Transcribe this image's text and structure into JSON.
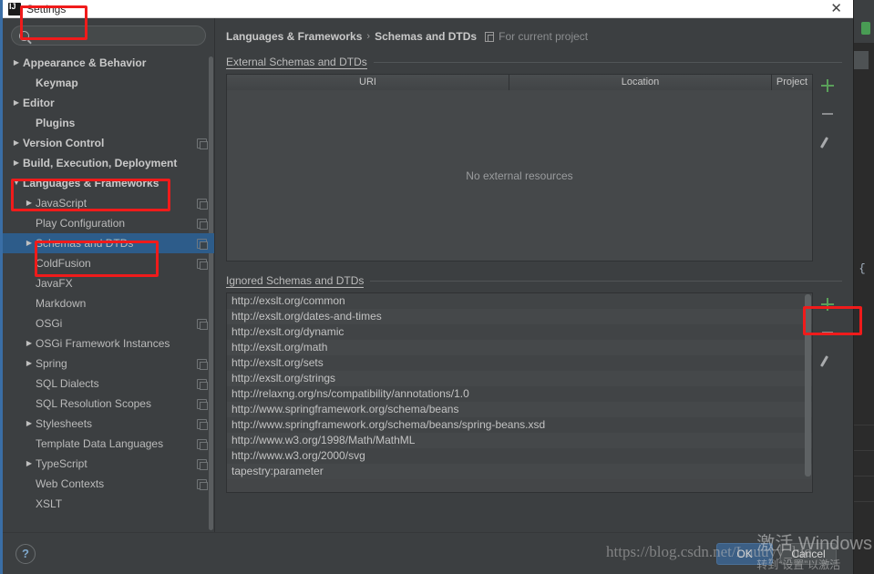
{
  "window": {
    "title": "Settings",
    "close_label": "✕"
  },
  "background": {
    "code_snippet": "n {"
  },
  "search": {
    "value": "",
    "placeholder": "",
    "icon": "search-icon"
  },
  "sidebar": {
    "scrollbar": "vertical-scrollbar",
    "items": [
      {
        "label": "Appearance & Behavior",
        "arrow": "▶",
        "indent": 1,
        "bold": true,
        "selected": false,
        "project_icon": false
      },
      {
        "label": "Keymap",
        "arrow": "",
        "indent": 2,
        "bold": true,
        "selected": false,
        "project_icon": false
      },
      {
        "label": "Editor",
        "arrow": "▶",
        "indent": 1,
        "bold": true,
        "selected": false,
        "project_icon": false
      },
      {
        "label": "Plugins",
        "arrow": "",
        "indent": 2,
        "bold": true,
        "selected": false,
        "project_icon": false
      },
      {
        "label": "Version Control",
        "arrow": "▶",
        "indent": 1,
        "bold": true,
        "selected": false,
        "project_icon": true
      },
      {
        "label": "Build, Execution, Deployment",
        "arrow": "▶",
        "indent": 1,
        "bold": true,
        "selected": false,
        "project_icon": false
      },
      {
        "label": "Languages & Frameworks",
        "arrow": "▼",
        "indent": 1,
        "bold": true,
        "selected": false,
        "project_icon": false
      },
      {
        "label": "JavaScript",
        "arrow": "▶",
        "indent": 2,
        "bold": false,
        "selected": false,
        "project_icon": true
      },
      {
        "label": "Play Configuration",
        "arrow": "",
        "indent": 3,
        "bold": false,
        "selected": false,
        "project_icon": true
      },
      {
        "label": "Schemas and DTDs",
        "arrow": "▶",
        "indent": 2,
        "bold": false,
        "selected": true,
        "project_icon": true
      },
      {
        "label": "ColdFusion",
        "arrow": "",
        "indent": 3,
        "bold": false,
        "selected": false,
        "project_icon": true
      },
      {
        "label": "JavaFX",
        "arrow": "",
        "indent": 3,
        "bold": false,
        "selected": false,
        "project_icon": false
      },
      {
        "label": "Markdown",
        "arrow": "",
        "indent": 3,
        "bold": false,
        "selected": false,
        "project_icon": false
      },
      {
        "label": "OSGi",
        "arrow": "",
        "indent": 3,
        "bold": false,
        "selected": false,
        "project_icon": true
      },
      {
        "label": "OSGi Framework Instances",
        "arrow": "▶",
        "indent": 2,
        "bold": false,
        "selected": false,
        "project_icon": false
      },
      {
        "label": "Spring",
        "arrow": "▶",
        "indent": 2,
        "bold": false,
        "selected": false,
        "project_icon": true
      },
      {
        "label": "SQL Dialects",
        "arrow": "",
        "indent": 3,
        "bold": false,
        "selected": false,
        "project_icon": true
      },
      {
        "label": "SQL Resolution Scopes",
        "arrow": "",
        "indent": 3,
        "bold": false,
        "selected": false,
        "project_icon": true
      },
      {
        "label": "Stylesheets",
        "arrow": "▶",
        "indent": 2,
        "bold": false,
        "selected": false,
        "project_icon": true
      },
      {
        "label": "Template Data Languages",
        "arrow": "",
        "indent": 3,
        "bold": false,
        "selected": false,
        "project_icon": true
      },
      {
        "label": "TypeScript",
        "arrow": "▶",
        "indent": 2,
        "bold": false,
        "selected": false,
        "project_icon": true
      },
      {
        "label": "Web Contexts",
        "arrow": "",
        "indent": 3,
        "bold": false,
        "selected": false,
        "project_icon": true
      },
      {
        "label": "XSLT",
        "arrow": "",
        "indent": 3,
        "bold": false,
        "selected": false,
        "project_icon": false
      }
    ]
  },
  "breadcrumb": {
    "parent": "Languages & Frameworks",
    "separator": "›",
    "current": "Schemas and DTDs",
    "scope_note": "For current project",
    "scope_icon": "project-scope-icon"
  },
  "external_section": {
    "title": "External Schemas and DTDs",
    "columns": [
      "URI",
      "Location",
      "Project"
    ],
    "rows": [],
    "empty_message": "No external resources",
    "toolbar": [
      {
        "name": "add-external-button",
        "icon": "plus-icon",
        "label": "+"
      },
      {
        "name": "remove-external-button",
        "icon": "minus-icon",
        "label": "−"
      },
      {
        "name": "edit-external-button",
        "icon": "pencil-icon",
        "label": "✎"
      }
    ]
  },
  "ignored_section": {
    "title": "Ignored Schemas and DTDs",
    "items": [
      "http://exslt.org/common",
      "http://exslt.org/dates-and-times",
      "http://exslt.org/dynamic",
      "http://exslt.org/math",
      "http://exslt.org/sets",
      "http://exslt.org/strings",
      "http://relaxng.org/ns/compatibility/annotations/1.0",
      "http://www.springframework.org/schema/beans",
      "http://www.springframework.org/schema/beans/spring-beans.xsd",
      "http://www.w3.org/1998/Math/MathML",
      "http://www.w3.org/2000/svg",
      "tapestry:parameter"
    ],
    "toolbar": [
      {
        "name": "add-ignored-button",
        "icon": "plus-icon",
        "label": "+"
      },
      {
        "name": "remove-ignored-button",
        "icon": "minus-icon",
        "label": "−"
      },
      {
        "name": "edit-ignored-button",
        "icon": "pencil-icon",
        "label": "✎"
      }
    ]
  },
  "footer": {
    "help_label": "?",
    "ok_label": "OK",
    "cancel_label": "Cancel"
  },
  "watermarks": {
    "url": "https://blog.csdn.net/Luuuyy_luo",
    "activate_line1": "激活 Windows",
    "activate_line2": "转到“设置”以激活"
  },
  "colors": {
    "accent_blue": "#3a6ea5",
    "selection_blue": "#2d5c8a",
    "annotation_red": "#f01b1b",
    "plus_green": "#5aa05a",
    "panel_bg": "#3c3f41"
  }
}
